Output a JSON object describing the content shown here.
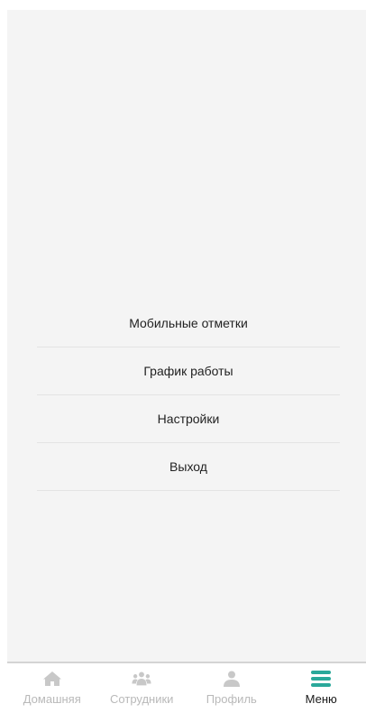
{
  "menu": {
    "items": [
      {
        "label": "Мобильные отметки"
      },
      {
        "label": "График работы"
      },
      {
        "label": "Настройки"
      },
      {
        "label": "Выход"
      }
    ]
  },
  "tabbar": {
    "tabs": [
      {
        "label": "Домашняя",
        "icon": "home-icon",
        "active": false
      },
      {
        "label": "Сотрудники",
        "icon": "users-icon",
        "active": false
      },
      {
        "label": "Профиль",
        "icon": "user-icon",
        "active": false
      },
      {
        "label": "Меню",
        "icon": "menu-icon",
        "active": true
      }
    ]
  },
  "colors": {
    "accent": "#2aa89a",
    "inactive_icon": "#c8c8c8",
    "inactive_label": "#b9b9b9",
    "active_label": "#1a1a1a",
    "background": "#f4f4f4"
  }
}
